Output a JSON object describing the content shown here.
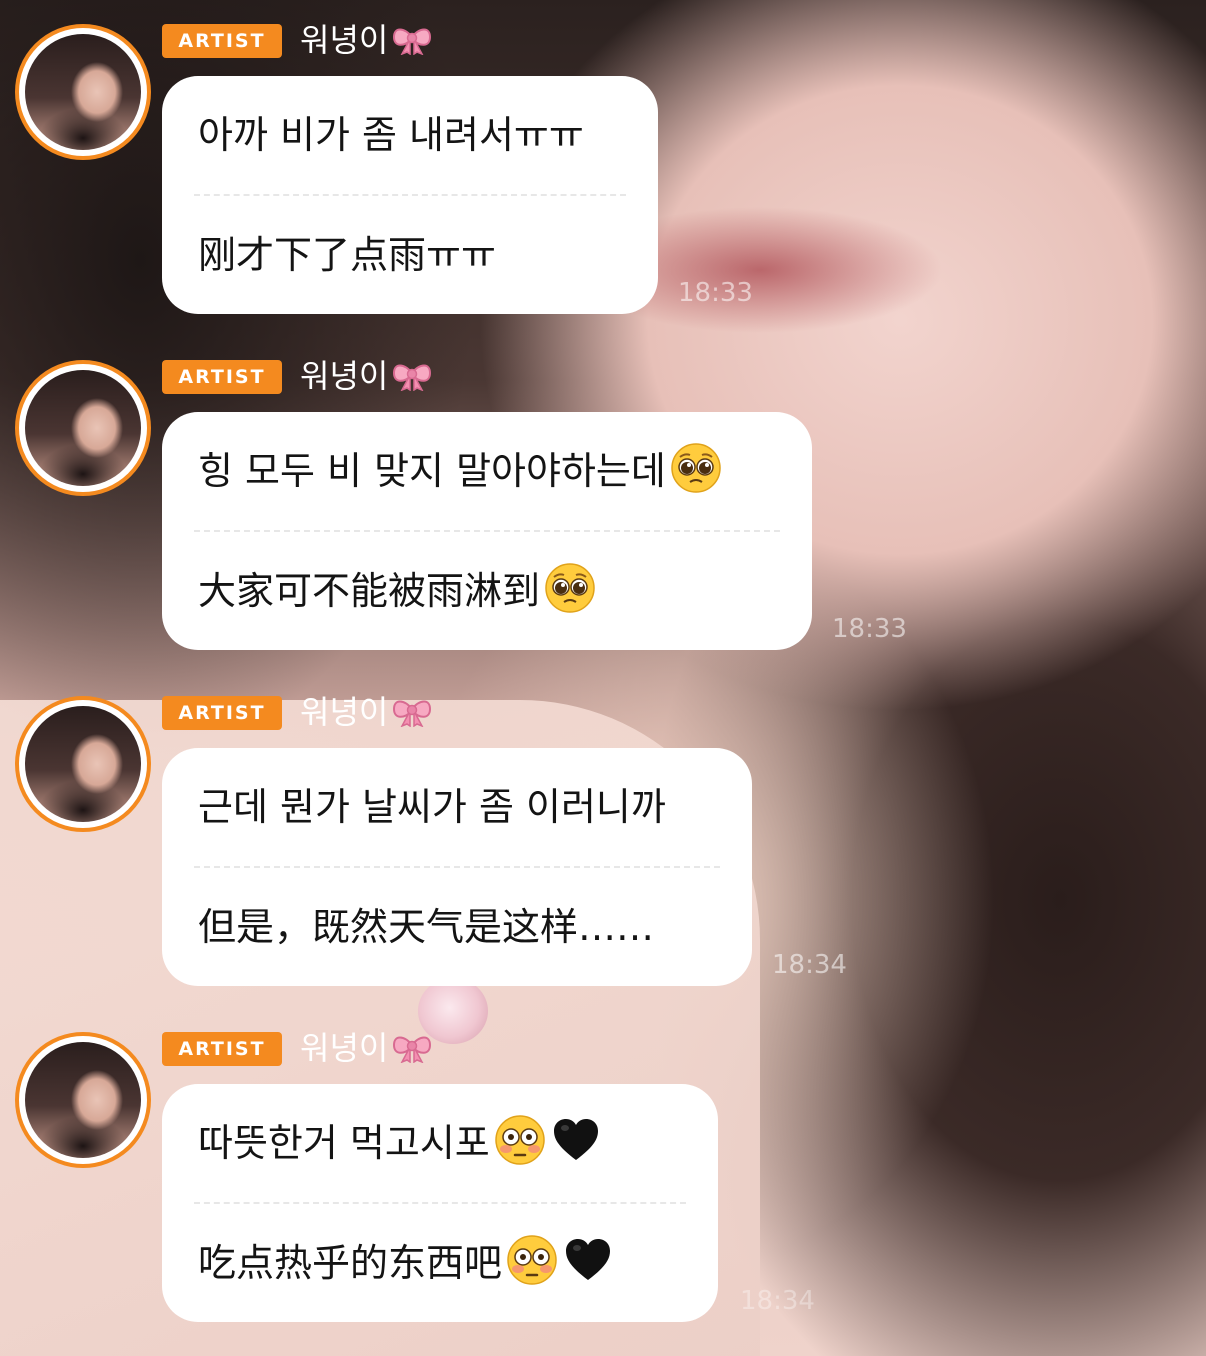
{
  "messages": [
    {
      "badge": "ARTIST",
      "author": "워녕이",
      "lines": [
        "아까 비가 좀 내려서ㅠㅠ",
        "刚才下了点雨ㅠㅠ"
      ],
      "time": "18:33"
    },
    {
      "badge": "ARTIST",
      "author": "워녕이",
      "lines": [
        "힝 모두 비 맞지 말아야하는데",
        "大家可不能被雨淋到"
      ],
      "time": "18:33"
    },
    {
      "badge": "ARTIST",
      "author": "워녕이",
      "lines": [
        "근데 뭔가 날씨가 좀 이러니까",
        "但是，既然天气是这样……"
      ],
      "time": "18:34"
    },
    {
      "badge": "ARTIST",
      "author": "워녕이",
      "lines": [
        "따뜻한거 먹고시포",
        "吃点热乎的东西吧"
      ],
      "time": "18:34"
    }
  ],
  "icons": {
    "author_suffix": "ribbon-bow-icon",
    "msg2_emoji": "pleading-face-icon",
    "msg4_emoji": [
      "flushed-face-icon",
      "black-heart-icon"
    ]
  },
  "colors": {
    "badge": "#f48a1f",
    "avatar_ring": "#f48a1f",
    "bubble": "#ffffff",
    "text": "#141414"
  }
}
